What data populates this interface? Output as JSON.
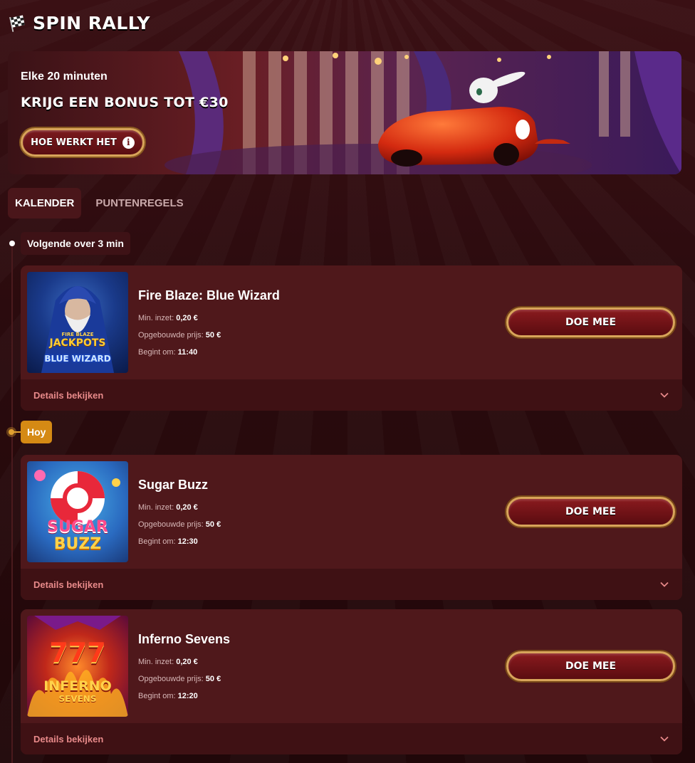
{
  "header": {
    "title": "SPIN RALLY",
    "icon": "checkered-flag-icon"
  },
  "banner": {
    "subtitle": "Elke 20 minuten",
    "headline": "KRIJG EEN BONUS TOT €30",
    "button_label": "HOE WERKT HET",
    "button_icon": "info-icon"
  },
  "tabs": [
    {
      "label": "KALENDER",
      "active": true
    },
    {
      "label": "PUNTENREGELS",
      "active": false
    }
  ],
  "timeline": {
    "next_label": "Volgende over 3 min",
    "today_label": "Hoy"
  },
  "labels": {
    "min_bet": "Min. inzet:",
    "built_prize": "Opgebouwde prijs:",
    "starts_at": "Begint om:",
    "join": "DOE MEE",
    "details": "Details bekijken"
  },
  "games": [
    {
      "title": "Fire Blaze: Blue Wizard",
      "min_bet": "0,20 €",
      "prize": "50 €",
      "start": "11:40",
      "thumb_line1": "FIRE BLAZE",
      "thumb_line2": "JACKPOTS",
      "thumb_line3": "BLUE WIZARD"
    },
    {
      "title": "Sugar Buzz",
      "min_bet": "0,20 €",
      "prize": "50 €",
      "start": "12:30",
      "thumb_line1": "SUGAR",
      "thumb_line2": "BUZZ"
    },
    {
      "title": "Inferno Sevens",
      "min_bet": "0,20 €",
      "prize": "50 €",
      "start": "12:20",
      "thumb_line1": "777",
      "thumb_line2": "INFERNO",
      "thumb_line3": "SEVENS"
    }
  ],
  "colors": {
    "background": "#2a0a0d",
    "card": "#4f181b",
    "card_footer": "#3f1114",
    "gold": "#d8a45a",
    "today_badge": "#d58a14",
    "details_text": "#e88a8a"
  }
}
